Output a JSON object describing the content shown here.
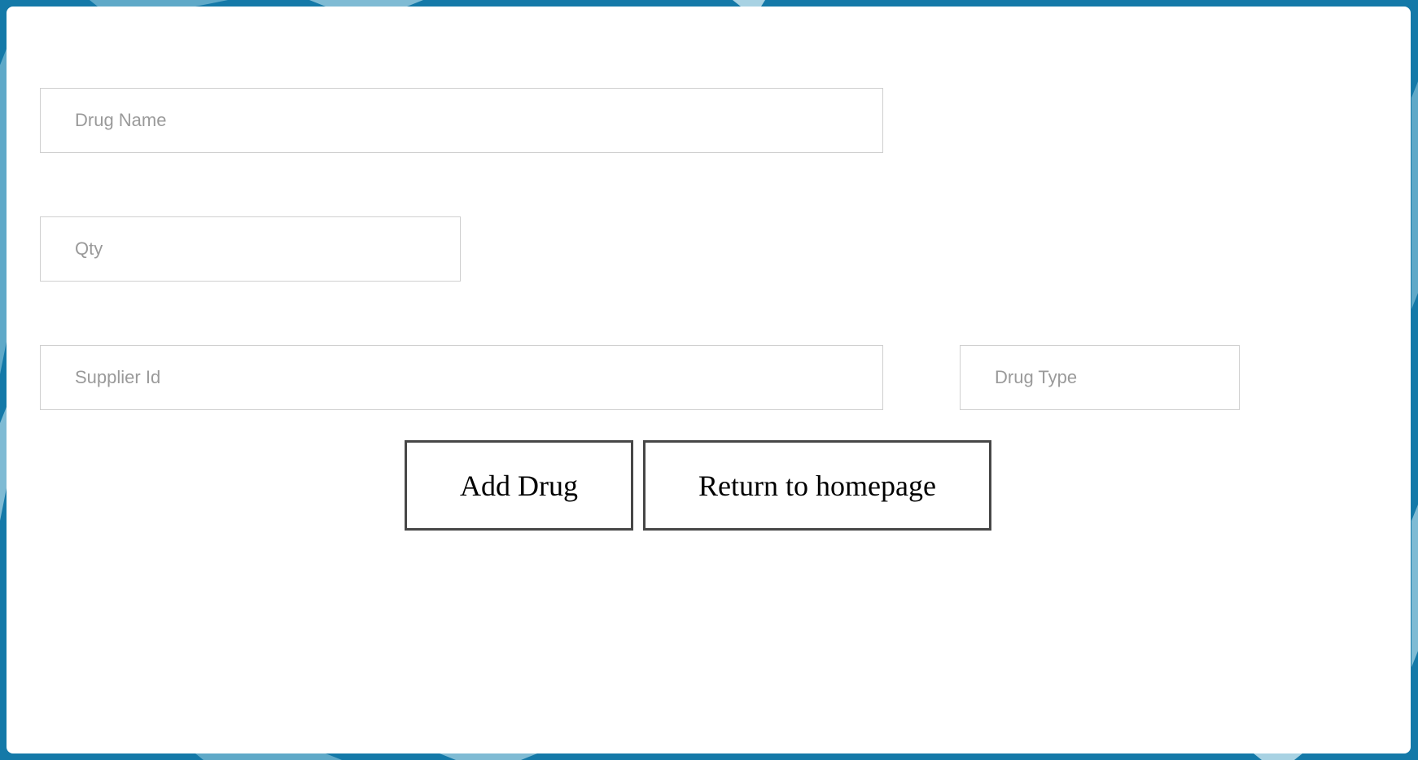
{
  "theme": {
    "background": "#1479a8",
    "card": "#ffffff",
    "field_border": "#cfcfcf",
    "placeholder": "#9a9a9a",
    "button_border": "#474747"
  },
  "form": {
    "drug_name": {
      "placeholder": "Drug Name",
      "value": ""
    },
    "qty": {
      "placeholder": "Qty",
      "value": ""
    },
    "supplier_id": {
      "placeholder": "Supplier Id",
      "value": ""
    },
    "drug_type": {
      "placeholder": "Drug Type",
      "value": ""
    }
  },
  "actions": {
    "add_drug_label": "Add Drug",
    "return_home_label": "Return to homepage"
  }
}
